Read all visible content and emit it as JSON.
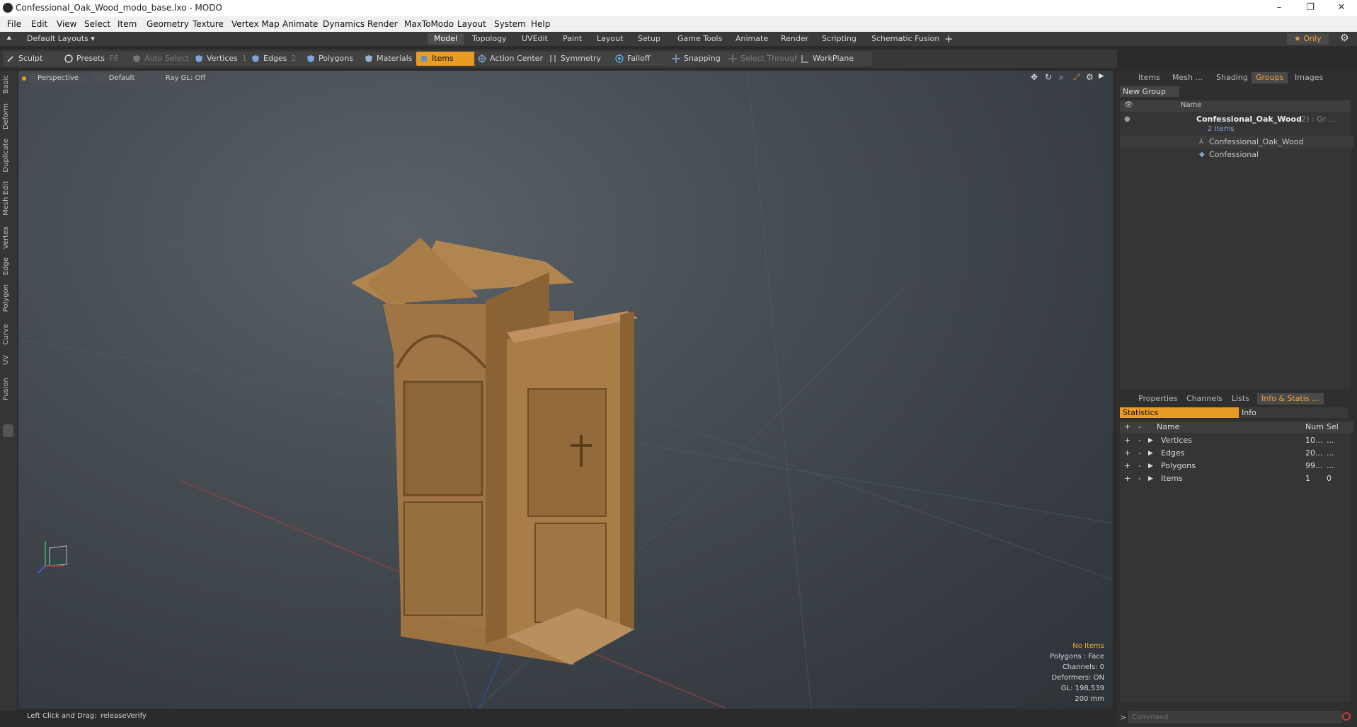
{
  "window": {
    "title": "Confessional_Oak_Wood_modo_base.lxo - MODO",
    "controls": [
      "–",
      "❐",
      "✕"
    ]
  },
  "menu": [
    "File",
    "Edit",
    "View",
    "Select",
    "Item",
    "Geometry",
    "Texture",
    "Vertex Map",
    "Animate",
    "Dynamics",
    "Render",
    "MaxToModo",
    "Layout",
    "System",
    "Help"
  ],
  "layoutbar": {
    "layouts_label": "Default Layouts ▾",
    "tabs": [
      "Model",
      "Topology",
      "UVEdit",
      "Paint",
      "Layout",
      "Setup",
      "Game Tools",
      "Animate",
      "Render",
      "Scripting",
      "Schematic Fusion"
    ],
    "active_tab": "Model",
    "add": "+",
    "only_label": "★  Only",
    "settings": "⚙"
  },
  "toolbar": {
    "sculpt": "Sculpt",
    "presets": "Presets",
    "presets_key": "F6",
    "auto_select": "Auto Select",
    "vertices": "Vertices",
    "vertices_count": "1",
    "edges": "Edges",
    "edges_count": "2",
    "polygons": "Polygons",
    "materials": "Materials",
    "items": "Items",
    "action_center": "Action Center",
    "symmetry": "Symmetry",
    "falloff": "Falloff",
    "snapping": "Snapping",
    "select_through": "Select Through",
    "workplane": "WorkPlane"
  },
  "left_tabs": [
    "Basic",
    "Deform",
    "Duplicate",
    "Mesh Edit",
    "Vertex",
    "Edge",
    "Polygon",
    "Curve",
    "UV",
    "Fusion"
  ],
  "viewport": {
    "perspective": "Perspective",
    "default": "Default",
    "raygl": "Ray GL: Off",
    "hud": {
      "no_items": "No Items",
      "polygons": "Polygons : Face",
      "channels": "Channels: 0",
      "deformers": "Deformers: ON",
      "gl": "GL: 198,539",
      "scale": "200 mm"
    }
  },
  "right_panel": {
    "top_tabs": [
      "Items",
      "Mesh ...",
      "Shading",
      "Groups",
      "Images"
    ],
    "top_active": "Groups",
    "new_group": "New Group",
    "name_header": "Name",
    "tree": {
      "group_name": "Confessional_Oak_Wood",
      "group_suffix": "(2) : Gr ...",
      "group_count": "2 Items",
      "children": [
        "Confessional_Oak_Wood",
        "Confessional"
      ]
    },
    "bottom_tabs": [
      "Properties",
      "Channels",
      "Lists",
      "Info & Statis ..."
    ],
    "bottom_active": "Info & Statis ...",
    "statistics_label": "Statistics",
    "info_label": "Info",
    "stats_headers": {
      "name": "Name",
      "num": "Num",
      "sel": "Sel"
    },
    "stats": [
      {
        "name": "Vertices",
        "num": "10...",
        "sel": "..."
      },
      {
        "name": "Edges",
        "num": "20...",
        "sel": "..."
      },
      {
        "name": "Polygons",
        "num": "99...",
        "sel": "..."
      },
      {
        "name": "Items",
        "num": "1",
        "sel": "0"
      }
    ],
    "command_placeholder": "Command"
  },
  "status": {
    "hint_label": "Left Click and Drag:",
    "hint_value": "releaseVerify"
  },
  "colors": {
    "accent": "#e89b25",
    "wood": "#a67c45"
  }
}
